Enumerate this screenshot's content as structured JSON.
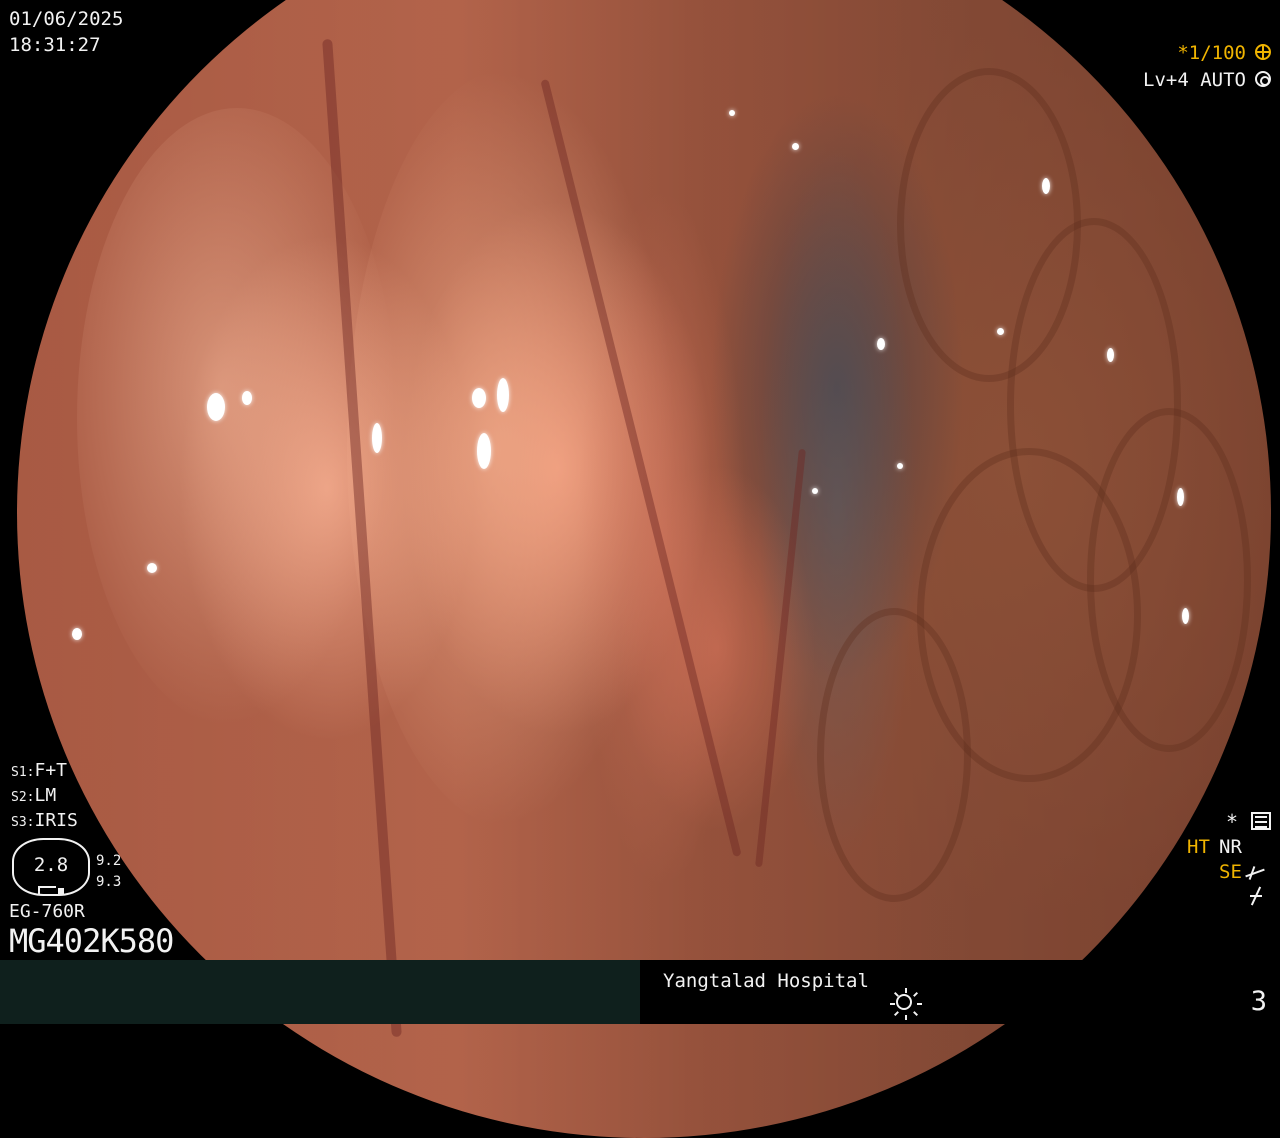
{
  "header": {
    "date": "01/06/2025",
    "time": "18:31:27",
    "shutter": "*1/100",
    "level": "Lv+4 AUTO"
  },
  "icons": {
    "shutter": "shutter-icon",
    "auto": "auto-exposure-icon",
    "settings": "settings-icon",
    "structure_enhance": "structure-enhance-icon",
    "freeze": "freeze-icon",
    "light": "light-source-icon"
  },
  "settings": {
    "s1_key": "S1:",
    "s1_val": "F+T",
    "s2_key": "S2:",
    "s2_val": "LM",
    "s3_key": "S3:",
    "s3_val": "IRIS"
  },
  "aperture": {
    "value": "2.8",
    "right_top": "9.2",
    "right_bottom": "9.3"
  },
  "scope": {
    "model": "EG-760R",
    "serial": "MG402K580"
  },
  "indicators": {
    "asterisk": "*",
    "ht": "HT",
    "nr": "NR",
    "se": "SE"
  },
  "footer": {
    "hospital": "Yangtalad Hospital",
    "page": "3"
  },
  "colors": {
    "accent": "#f0b400",
    "text": "#f2f2f2",
    "bar": "#0f201d"
  }
}
